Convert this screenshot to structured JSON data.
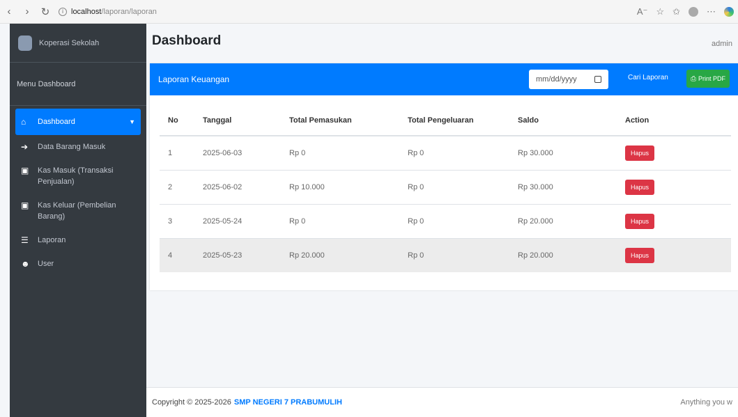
{
  "browser": {
    "url_host": "localhost",
    "url_path": "/laporan/laporan"
  },
  "sidebar": {
    "brand": "Koperasi Sekolah",
    "menu_header": "Menu Dashboard",
    "items": [
      {
        "label": "Dashboard",
        "icon": "home-icon",
        "active": true
      },
      {
        "label": "Data Barang Masuk",
        "icon": "arrow-right-icon"
      },
      {
        "label": "Kas Masuk (Transaksi Penjualan)",
        "icon": "money-icon"
      },
      {
        "label": "Kas Keluar (Pembelian Barang)",
        "icon": "money-icon"
      },
      {
        "label": "Laporan",
        "icon": "list-icon"
      },
      {
        "label": "User",
        "icon": "users-icon"
      }
    ]
  },
  "header": {
    "title": "Dashboard",
    "user": "admin"
  },
  "card": {
    "title": "Laporan Keuangan",
    "date_placeholder": "mm/dd/yyyy",
    "search_label": "Cari Laporan",
    "print_label": "Print PDF"
  },
  "table": {
    "columns": [
      "No",
      "Tanggal",
      "Total Pemasukan",
      "Total Pengeluaran",
      "Saldo",
      "Action"
    ],
    "rows": [
      {
        "no": "1",
        "tanggal": "2025-06-03",
        "pemasukan": "Rp 0",
        "pengeluaran": "Rp 0",
        "saldo": "Rp 30.000",
        "action": "Hapus"
      },
      {
        "no": "2",
        "tanggal": "2025-06-02",
        "pemasukan": "Rp 10.000",
        "pengeluaran": "Rp 0",
        "saldo": "Rp 30.000",
        "action": "Hapus"
      },
      {
        "no": "3",
        "tanggal": "2025-05-24",
        "pemasukan": "Rp 0",
        "pengeluaran": "Rp 0",
        "saldo": "Rp 20.000",
        "action": "Hapus"
      },
      {
        "no": "4",
        "tanggal": "2025-05-23",
        "pemasukan": "Rp 20.000",
        "pengeluaran": "Rp 0",
        "saldo": "Rp 20.000",
        "action": "Hapus"
      }
    ]
  },
  "footer": {
    "copyright": "Copyright © 2025-2026",
    "school": "SMP NEGERI 7 PRABUMULIH",
    "right_text": "Anything you w"
  },
  "colors": {
    "primary": "#007bff",
    "sidebar": "#343a40",
    "success": "#28a745",
    "danger": "#dc3545"
  }
}
